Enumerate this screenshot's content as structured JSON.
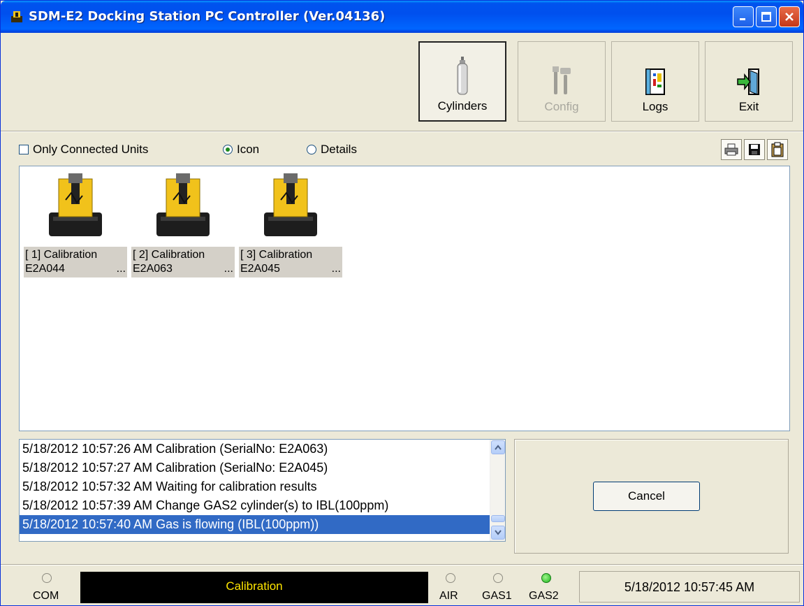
{
  "app": {
    "title": "SDM-E2 Docking Station PC Controller (Ver.04136)"
  },
  "toolbar": {
    "buttons": [
      {
        "label": "Cylinders",
        "icon": "cylinder-icon",
        "state": "pressed"
      },
      {
        "label": "Config",
        "icon": "tools-icon",
        "state": "disabled"
      },
      {
        "label": "Logs",
        "icon": "logbook-icon",
        "state": "normal"
      },
      {
        "label": "Exit",
        "icon": "exit-door-icon",
        "state": "normal"
      }
    ]
  },
  "view_options": {
    "only_connected_label": "Only Connected Units",
    "only_connected_checked": false,
    "icon_label": "Icon",
    "details_label": "Details",
    "selected_view": "Icon",
    "action_icons": [
      "printer-icon",
      "save-icon",
      "clipboard-icon"
    ]
  },
  "units": [
    {
      "slot": "[ 1] Calibration",
      "serial": "E2A044",
      "more": "..."
    },
    {
      "slot": "[ 2] Calibration",
      "serial": "E2A063",
      "more": "..."
    },
    {
      "slot": "[ 3] Calibration",
      "serial": "E2A045",
      "more": "..."
    }
  ],
  "log": {
    "lines": [
      "5/18/2012 10:57:26 AM Calibration (SerialNo: E2A063)",
      "5/18/2012 10:57:27 AM Calibration (SerialNo: E2A045)",
      "5/18/2012 10:57:32 AM Waiting for calibration results",
      "5/18/2012 10:57:39 AM Change GAS2 cylinder(s) to IBL(100ppm)",
      "5/18/2012 10:57:40 AM Gas is flowing (IBL(100ppm))"
    ],
    "selected_index": 4
  },
  "cancel_label": "Cancel",
  "status": {
    "com_label": "COM",
    "message": "Calibration",
    "air_label": "AIR",
    "gas1_label": "GAS1",
    "gas2_label": "GAS2",
    "gas2_active": true,
    "datetime": "5/18/2012 10:57:45 AM",
    "message_color": "#ffe600",
    "led_on_color": "#1bb41b"
  }
}
